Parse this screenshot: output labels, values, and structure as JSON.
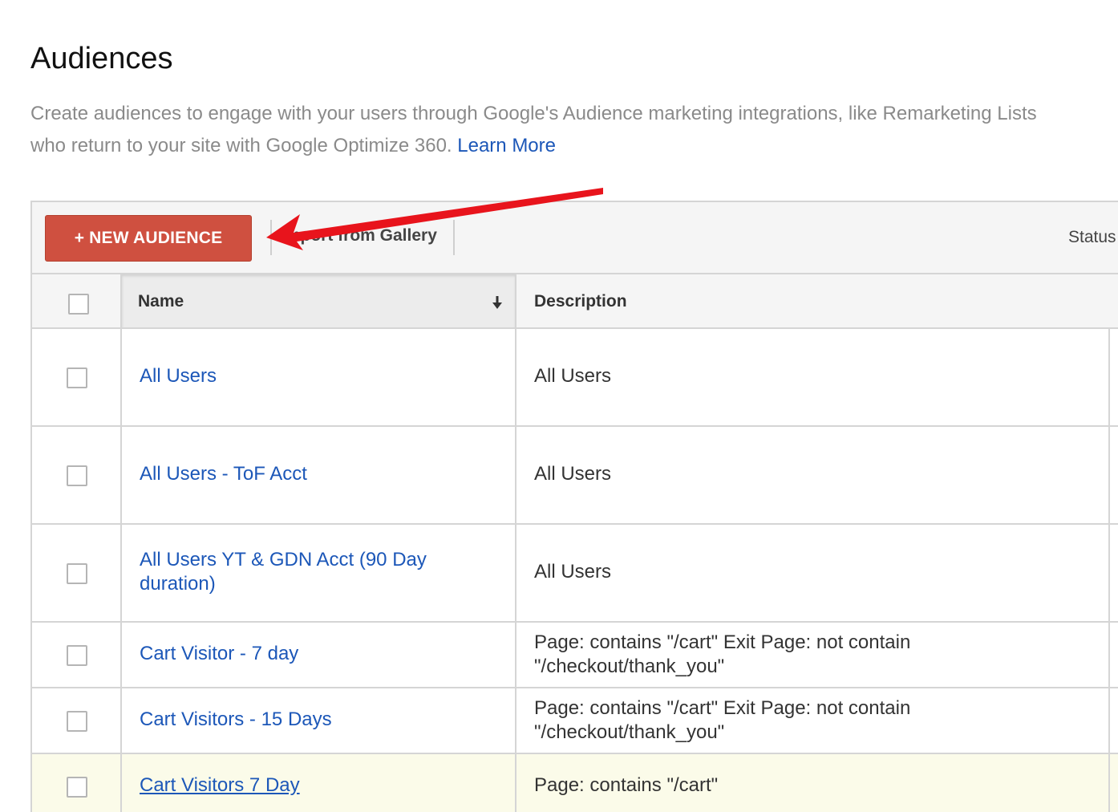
{
  "page": {
    "title": "Audiences",
    "intro_text": "Create audiences to engage with your users through Google's Audience marketing integrations, like Remarketing Lists",
    "intro_text_line2": "who return to your site with Google Optimize 360.",
    "learn_more": "Learn More"
  },
  "toolbar": {
    "new_audience_label": "+ NEW AUDIENCE",
    "import_label": "Import from Gallery",
    "status_label": "Status"
  },
  "table": {
    "columns": [
      "Name",
      "Description"
    ],
    "rows": [
      {
        "name": "All Users",
        "description": "All Users"
      },
      {
        "name": "All Users - ToF Acct",
        "description": "All Users"
      },
      {
        "name": "All Users YT & GDN Acct (90 Day duration)",
        "description": "All Users"
      },
      {
        "name": "Cart Visitor - 7 day",
        "description": "Page: contains \"/cart\" Exit Page: not contain \"/checkout/thank_you\""
      },
      {
        "name": "Cart Visitors - 15 Days",
        "description": "Page: contains \"/cart\" Exit Page: not contain \"/checkout/thank_you\""
      },
      {
        "name": "Cart Visitors 7 Day",
        "description": "Page: contains \"/cart\""
      }
    ]
  },
  "colors": {
    "primary_button": "#cf5040",
    "link": "#1c57b8",
    "annotation_arrow": "#e8141c",
    "highlight_row": "#fbfbe9"
  },
  "icons": {
    "sort": "sort-down-icon",
    "annotation": "red-arrow-annotation"
  }
}
